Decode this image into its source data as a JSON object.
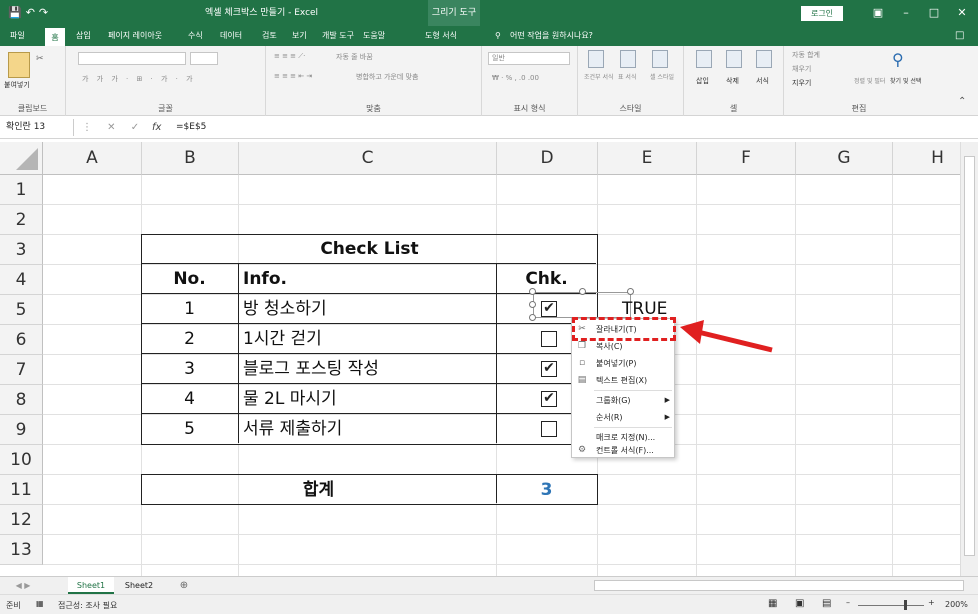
{
  "window": {
    "title": "엑셀 체크박스 만들기 - Excel",
    "tools_tab": "그리기 도구",
    "login": "로그인"
  },
  "tabs": [
    "파일",
    "홈",
    "삽입",
    "페이지 레이아웃",
    "수식",
    "데이터",
    "검토",
    "보기",
    "개발 도구",
    "도움말",
    "도형 서식"
  ],
  "tellme": "어떤 작업을 원하시나요?",
  "ribbon": {
    "paste": "붙여넣기",
    "clipboard": "클립보드",
    "font": "글꼴",
    "align": "맞춤",
    "number": "표시 형식",
    "styles": "스타일",
    "cells": "셀",
    "edit": "편집",
    "wrap": "자동 줄 바꿈",
    "merge": "병합하고 가운데 맞춤",
    "general": "일반",
    "cond": "조건부 서식",
    "tbl": "표 서식",
    "cellstyle": "셀 스타일",
    "insert": "삽입",
    "delete": "삭제",
    "format": "서식",
    "autosum": "자동 합계",
    "fill": "채우기",
    "clear": "지우기",
    "sortfilter": "정렬 및 필터",
    "findselect": "찾기 및 선택"
  },
  "formula": {
    "namebox": "확인란 13",
    "value": "=$E$5"
  },
  "columns": [
    "A",
    "B",
    "C",
    "D",
    "E",
    "F",
    "G",
    "H"
  ],
  "rows": [
    "1",
    "2",
    "3",
    "4",
    "5",
    "6",
    "7",
    "8",
    "9",
    "10",
    "11",
    "12",
    "13"
  ],
  "table": {
    "title": "Check List",
    "headers": [
      "No.",
      "Info.",
      "Chk."
    ],
    "items": [
      {
        "no": "1",
        "info": "방 청소하기"
      },
      {
        "no": "2",
        "info": "1시간 걷기"
      },
      {
        "no": "3",
        "info": "블로그 포스팅 작성"
      },
      {
        "no": "4",
        "info": "물 2L 마시기"
      },
      {
        "no": "5",
        "info": "서류 제출하기"
      }
    ],
    "checked": [
      true,
      false,
      true,
      true,
      false
    ],
    "total_label": "합계",
    "total_value": "3"
  },
  "e5": "TRUE",
  "context_menu": [
    {
      "label": "잘라내기(T)",
      "icon": "scissors-icon"
    },
    {
      "label": "복사(C)",
      "icon": "copy-icon"
    },
    {
      "label": "붙여넣기(P)",
      "icon": "paste-icon"
    },
    {
      "label": "텍스트 편집(X)",
      "icon": "text-edit-icon"
    },
    {
      "label": "그룹화(G)",
      "icon": ""
    },
    {
      "label": "순서(R)",
      "icon": ""
    },
    {
      "label": "매크로 지정(N)...",
      "icon": ""
    },
    {
      "label": "컨트롤 서식(F)...",
      "icon": "control-format-icon"
    }
  ],
  "sheets": [
    "Sheet1",
    "Sheet2"
  ],
  "status": {
    "ready": "준비",
    "access": "접근성: 조사 필요",
    "zoom": "200%"
  },
  "colors": {
    "excel_green": "#217346",
    "dash": "#e02020",
    "total": "#2e75b6"
  }
}
